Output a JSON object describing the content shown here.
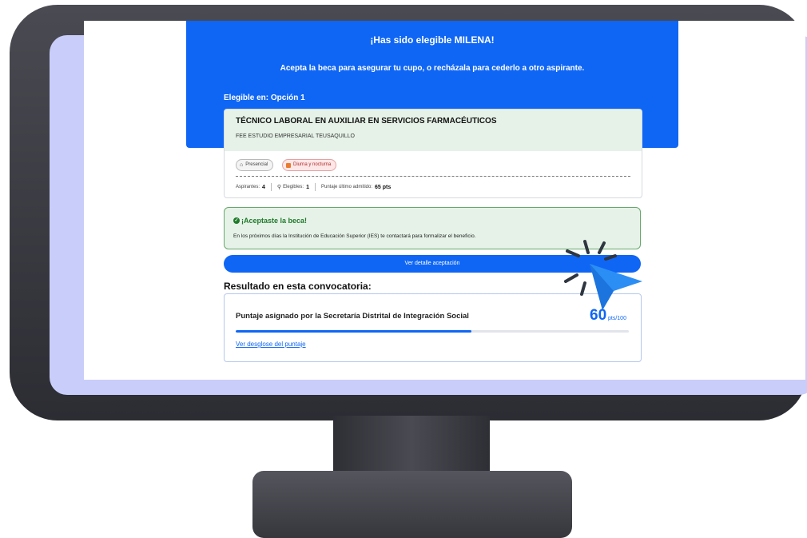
{
  "hero": {
    "title": "¡Has sido elegible MILENA!",
    "subtitle": "Acepta la beca para asegurar tu cupo, o recházala para cederlo a otro aspirante.",
    "eligible_label": "Elegible en: Opción 1"
  },
  "program": {
    "name": "TÉCNICO LABORAL EN AUXILIAR EN SERVICIOS FARMACÉUTICOS",
    "institution": "FEE ESTUDIO EMPRESARIAL TEUSAQUILLO",
    "chips": [
      {
        "label": "Presencial",
        "icon": "school-icon"
      },
      {
        "label": "Diurna y nocturna",
        "icon": "calendar-icon"
      }
    ],
    "stats": {
      "aspirantes_label": "Aspirantes:",
      "aspirantes_value": "4",
      "elegibles_label": "Elegibles:",
      "elegibles_value": "1",
      "puntaje_label": "Puntaje último admitido:",
      "puntaje_value": "65 pts"
    }
  },
  "acceptance": {
    "title": "¡Aceptaste la beca!",
    "body": "En los próximos días la Institución de Educación Superior (IES) te contactará para formalizar el beneficio.",
    "button_label": "Ver detalle aceptación"
  },
  "result": {
    "heading": "Resultado en esta convocatoria:",
    "score_label": "Puntaje asignado por la Secretaría Distrital de Integración Social",
    "score_value": "60",
    "score_unit": "pts/100",
    "score_fraction": 0.6,
    "breakdown_link": "Ver desglose del puntaje"
  },
  "colors": {
    "primary": "#0f66f5",
    "success": "#1f7a2a",
    "success_bg": "#e6f2e8",
    "chip_red": "#b12d2d",
    "monitor_dark": "#2c2c33",
    "monitor_bezel": "#c9cdfa"
  }
}
